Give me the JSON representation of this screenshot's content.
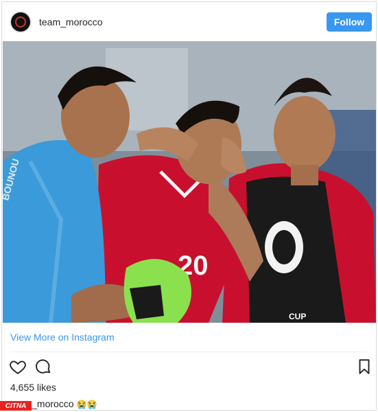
{
  "post": {
    "username": "team_morocco",
    "follow_label": "Follow",
    "view_more_label": "View More on Instagram",
    "likes_text": "4,655 likes",
    "caption_username": "team_morocco",
    "caption_text": "😭😭"
  },
  "photo": {
    "jersey_number": "20",
    "keeper_shirt_text": "BOUNOU",
    "ball_logo_text": "CUP"
  },
  "icons": {
    "heart": "heart-icon",
    "comment": "comment-icon",
    "bookmark": "bookmark-icon"
  },
  "watermark": {
    "text": "CITNA"
  },
  "colors": {
    "follow_button": "#3897f0",
    "link": "#3897f0",
    "red_jersey": "#c8102e",
    "keeper_jersey": "#3b9ad9",
    "glove": "#8be04e"
  }
}
